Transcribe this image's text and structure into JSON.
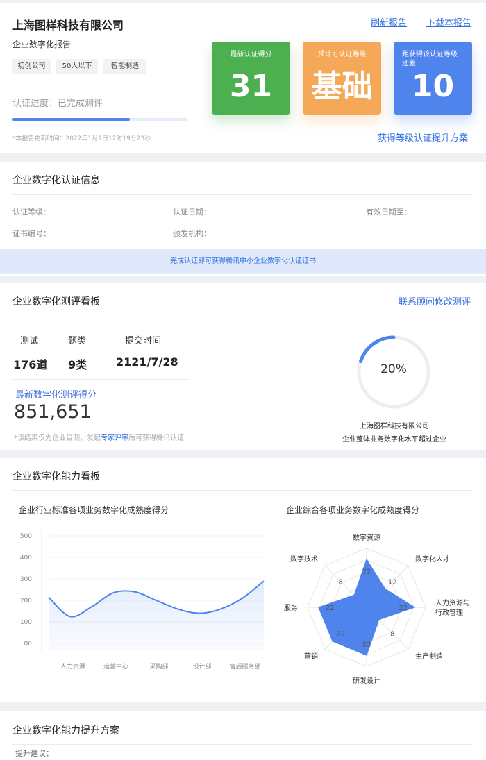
{
  "company": "上海图样科技有限公司",
  "report_title": "企业数字化报告",
  "tags": [
    "初创公司",
    "50人以下",
    "智能制造"
  ],
  "actions": {
    "refresh": "刷新报告",
    "download": "下载本报告",
    "upgrade_plan": "获得等级认证提升方案"
  },
  "progress": {
    "label": "认证进度：已完成测评",
    "fraction": 0.67
  },
  "update_time": "*本报告更新时间：2022年1月1日12时19分23秒",
  "tiles": [
    {
      "label": "最新认证得分",
      "value": "31",
      "color": "#4caf50"
    },
    {
      "label": "预计可认证等级",
      "value": "基础",
      "color": "#f5a857"
    },
    {
      "label": "距获得该认证等级还差",
      "value": "10",
      "color": "#4f84ec"
    }
  ],
  "cert": {
    "title": "企业数字化认证信息",
    "level": "认证等级：",
    "date": "认证日期：",
    "valid": "有效日期至：",
    "number": "证书编号：",
    "issuer": "颁发机构：",
    "banner": "完成认证即可获得腾讯中小企业数字化认证证书"
  },
  "evaluation": {
    "title": "企业数字化测评看板",
    "contact": "联系顾问修改测评",
    "stats": [
      {
        "label": "测试",
        "value": "176道"
      },
      {
        "label": "题类",
        "value": "9类"
      },
      {
        "label": "提交时间",
        "value": "2121/7/28"
      }
    ],
    "score_label": "最新数字化测评得分",
    "score": "851,651",
    "note_prefix": "*该结果仅为企业自测，发起",
    "note_link": "专家评审",
    "note_suffix": "后可获得腾讯认证",
    "ring_percent": 20,
    "ring_text": "20%",
    "ring_caption_1": "上海图样科技有限公司",
    "ring_caption_2": "企业整体业务数字化水平超过企业"
  },
  "ability": {
    "title": "企业数字化能力看板",
    "line_chart_title": "企业行业标准各项业务数字化成熟度得分",
    "radar_chart_title": "企业综合各项业务数字化成熟度得分"
  },
  "chart_data": [
    {
      "type": "line",
      "title": "企业行业标准各项业务数字化成熟度得分",
      "y_ticks": [
        "500",
        "400",
        "300",
        "200",
        "100",
        "00"
      ],
      "ylim": [
        0,
        500
      ],
      "categories": [
        "人力资源",
        "运营中心",
        "采购部",
        "设计部",
        "售后服务部"
      ],
      "x": [
        0,
        0.5,
        1.0,
        1.5,
        2.0,
        2.5,
        3.0,
        3.5,
        4.0,
        4.5,
        5.0
      ],
      "values": [
        215,
        125,
        170,
        235,
        240,
        200,
        160,
        140,
        160,
        210,
        290
      ],
      "color": "#4f84ec"
    },
    {
      "type": "radar",
      "title": "企业综合各项业务数字化成熟度得分",
      "axes": [
        "数字资源",
        "数字化人才",
        "人力资源与行政管理",
        "生产制造",
        "研发设计",
        "营销",
        "服务",
        "数字技术"
      ],
      "axis_labels": [
        "数字资源",
        "数字化人才",
        "人力资源与\n行政管理",
        "生产制造",
        "研发设计",
        "营销",
        "服务",
        "数字技术"
      ],
      "values": [
        22,
        12,
        22,
        8,
        22,
        22,
        22,
        8
      ],
      "max": 27,
      "color": "#4f84ec"
    }
  ],
  "improvement": {
    "title": "企业数字化能力提升方案",
    "suggestion_label": "提升建议："
  }
}
